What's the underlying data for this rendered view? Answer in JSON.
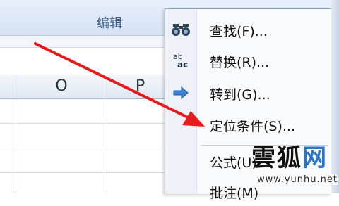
{
  "ribbon": {
    "group_label": "编辑"
  },
  "columns": [
    "O",
    "P"
  ],
  "menu": {
    "items": [
      {
        "label": "查找(F)...",
        "icon": "binoculars-icon"
      },
      {
        "label": "替换(R)...",
        "icon": "replace-ab-ac-icon",
        "icon_text_top": "ab",
        "icon_text_bottom": "ac"
      },
      {
        "label": "转到(G)...",
        "icon": "arrow-right-icon"
      },
      {
        "label": "定位条件(S)...",
        "icon": ""
      },
      {
        "label": "公式(U)",
        "icon": ""
      },
      {
        "label": "批注(M)",
        "icon": ""
      }
    ]
  },
  "watermark": {
    "brand": "雲狐",
    "net": "网",
    "url": "www.yunhu.net"
  },
  "annotation": {
    "arrow_color": "#e8191b"
  }
}
